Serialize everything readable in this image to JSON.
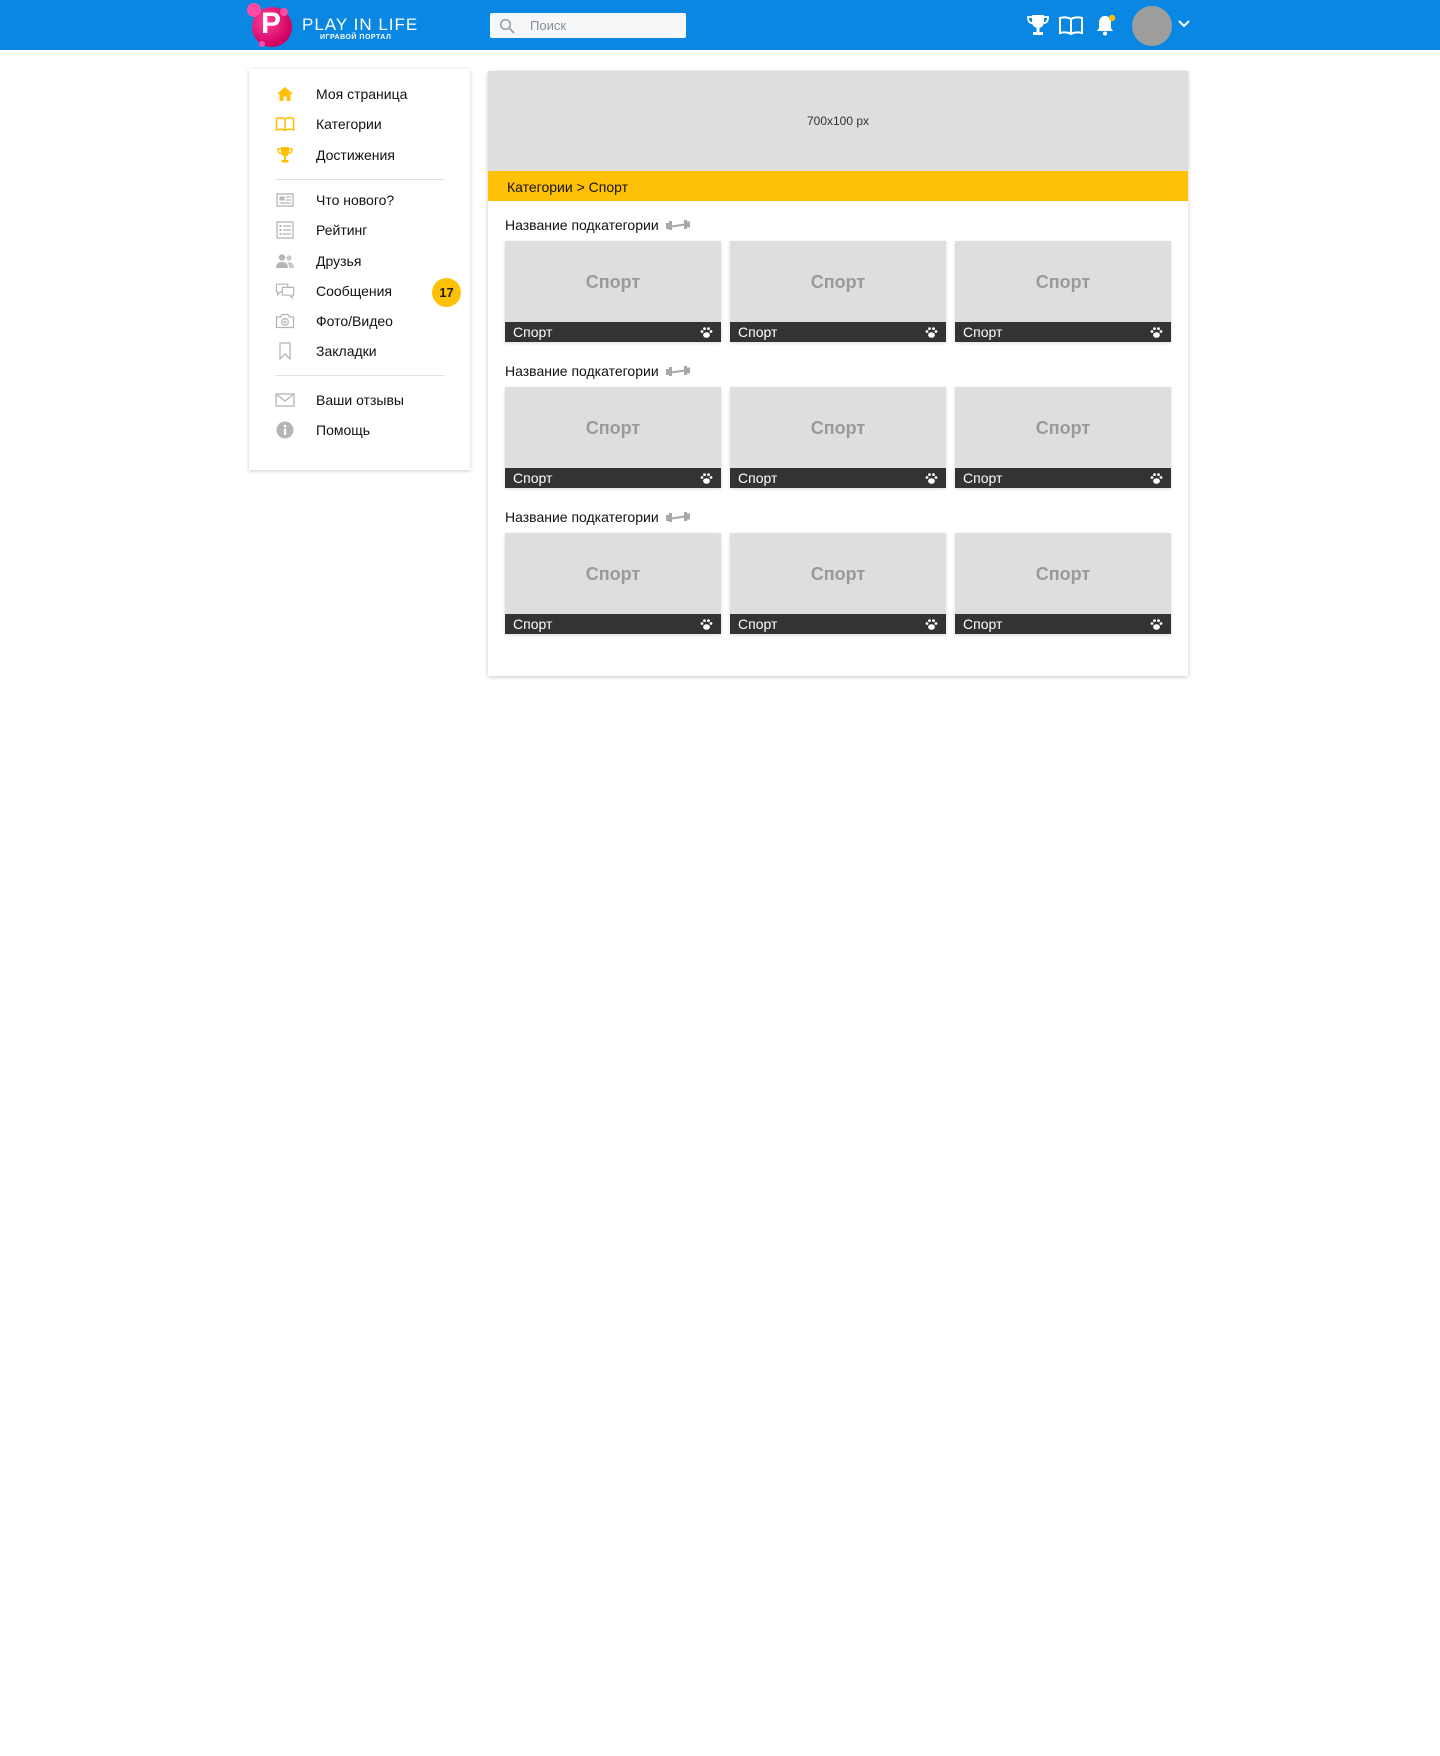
{
  "header": {
    "logo_title": "PLAY IN LIFE",
    "logo_subtitle": "ИГРАВОЙ ПОРТАЛ",
    "logo_letter": "P",
    "search_placeholder": "Поиск",
    "icons": [
      "trophy-icon",
      "book-icon",
      "bell-icon",
      "avatar",
      "chevron-down-icon"
    ],
    "colors": {
      "bar": "#0a87e3",
      "notification_dot": "#ffc107"
    }
  },
  "sidebar": {
    "items": [
      {
        "label": "Моя страница",
        "icon": "home-icon"
      },
      {
        "label": "Категории",
        "icon": "book-icon"
      },
      {
        "label": "Достижения",
        "icon": "trophy-icon"
      },
      {
        "label": "Что нового?",
        "icon": "newspaper-icon"
      },
      {
        "label": "Рейтинг",
        "icon": "list-icon"
      },
      {
        "label": "Друзья",
        "icon": "friends-icon"
      },
      {
        "label": "Сообщения",
        "icon": "messages-icon",
        "badge": "17"
      },
      {
        "label": "Фото/Видео",
        "icon": "camera-icon"
      },
      {
        "label": "Закладки",
        "icon": "bookmark-icon"
      },
      {
        "label": "Ваши отзывы",
        "icon": "envelope-icon"
      },
      {
        "label": "Помощь",
        "icon": "info-icon"
      }
    ],
    "colors": {
      "active_icon": "#ffc107",
      "muted_icon": "#b5b5b5",
      "badge": "#ffc107"
    }
  },
  "main": {
    "banner_text": "700x100 px",
    "breadcrumb": "Категории > Спорт",
    "sections": [
      {
        "title": "Название подкатегории",
        "cards": [
          {
            "title": "Спорт",
            "label": "Спорт"
          },
          {
            "title": "Спорт",
            "label": "Спорт"
          },
          {
            "title": "Спорт",
            "label": "Спорт"
          }
        ]
      },
      {
        "title": "Название подкатегории",
        "cards": [
          {
            "title": "Спорт",
            "label": "Спорт"
          },
          {
            "title": "Спорт",
            "label": "Спорт"
          },
          {
            "title": "Спорт",
            "label": "Спорт"
          }
        ]
      },
      {
        "title": "Название подкатегории",
        "cards": [
          {
            "title": "Спорт",
            "label": "Спорт"
          },
          {
            "title": "Спорт",
            "label": "Спорт"
          },
          {
            "title": "Спорт",
            "label": "Спорт"
          }
        ]
      }
    ],
    "colors": {
      "breadcrumb_bg": "#ffc107",
      "card_bg": "#dedede",
      "card_bar": "#333333"
    }
  }
}
